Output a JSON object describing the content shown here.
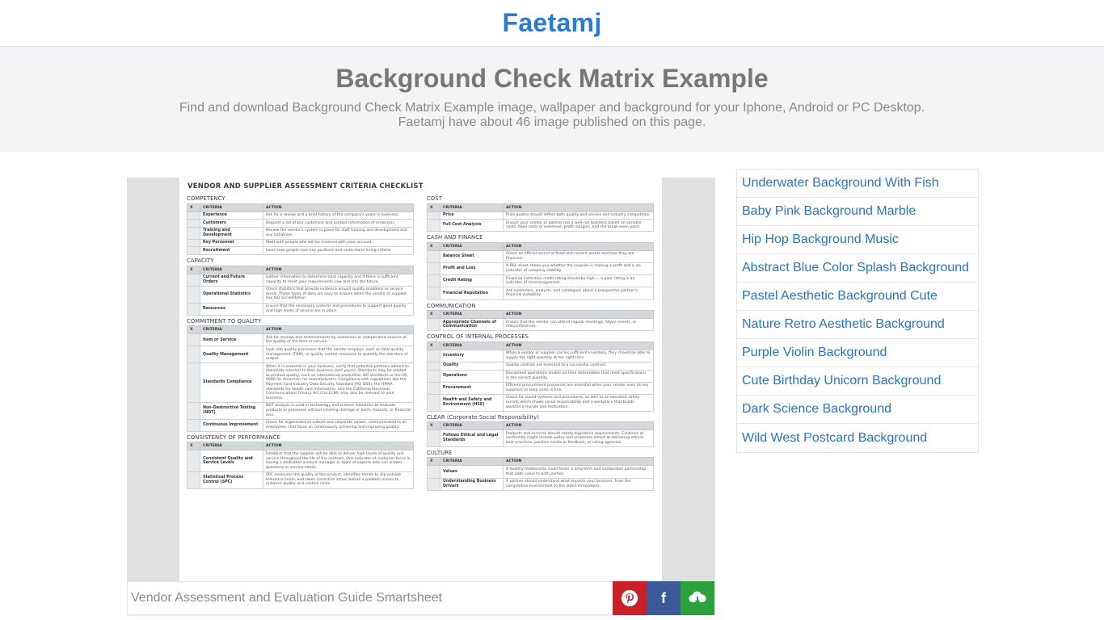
{
  "site": {
    "brand": "Faetamj"
  },
  "hero": {
    "title": "Background Check Matrix Example",
    "description_line1": "Find and download Background Check Matrix Example image, wallpaper and background for your Iphone, Android or PC Desktop.",
    "description_line2": "Faetamj have about 46 image published on this page."
  },
  "image": {
    "caption": "Vendor Assessment and Evaluation Guide Smartsheet",
    "document": {
      "title": "VENDOR AND SUPPLIER ASSESSMENT CRITERIA CHECKLIST",
      "headers": {
        "x": "X",
        "criteria": "CRITERIA",
        "action": "ACTION"
      },
      "left_sections": [
        {
          "title": "COMPETENCY",
          "rows": [
            {
              "criteria": "Experience",
              "action": "Ask for a review and a brief history of the company's years in business."
            },
            {
              "criteria": "Customers",
              "action": "Request a list of key customers and contact information of endorsers."
            },
            {
              "criteria": "Training and Development",
              "action": "Review the vendor's system in place for staff training and development and any initiatives."
            },
            {
              "criteria": "Key Personnel",
              "action": "Meet with people who will be involved with your account."
            },
            {
              "criteria": "Recruitment",
              "action": "Learn how people earn key positions and understand hiring criteria."
            }
          ]
        },
        {
          "title": "CAPACITY",
          "rows": [
            {
              "criteria": "Current and Future Orders",
              "action": "Gather information to determine total capacity and if there is sufficient capacity to meet your requirements now and into the future."
            },
            {
              "criteria": "Operational Statistics",
              "action": "Check statistics that provide evidence around quality problems or service levels. These types of data are easy to acquire when the vendor or supplier has ISO accreditation."
            },
            {
              "criteria": "Resources",
              "action": "Ensure that the necessary systems and procedures to support good quality and high levels of service are in place."
            }
          ]
        },
        {
          "title": "COMMITMENT TO QUALITY",
          "rows": [
            {
              "criteria": "Item or Service",
              "action": "Ask for reviews and endorsements by customers or independent sources of the quality of the item or service."
            },
            {
              "criteria": "Quality Management",
              "action": "Look into quality processes that the vendor employs, such as total quality management (TQM), or quality control measures to quantify the standard of output."
            },
            {
              "criteria": "Standards Compliance",
              "action": "When it is essential in your business, verify that potential partners adhere to standards relevant to their business (and yours). Standards may be related to product quality, such as international production ISO standards or the QS 9000 for American car manufacturers. Compliance with regulations like the Payment Card Industry Data Security Standard (PCI DSS), the HIPAA standards for health care information, and the California Electronic Communications Privacy Act (Cal ECPA) may also be relevant to your business."
            },
            {
              "criteria": "Non-Destructive Testing (NDT)",
              "action": "NDT analysis is used in technology and science industries to evaluate products or processes without creating damage or harm, hazards, or financial loss."
            },
            {
              "criteria": "Continuous Improvement",
              "action": "Check for organizational culture and corporate values, communicated to all employees, that focus on continuously achieving and improving quality."
            }
          ]
        },
        {
          "title": "CONSISTENCY OF PERFORMANCE",
          "rows": [
            {
              "criteria": "Consistent Quality and Service Levels",
              "action": "Establish that the supplier will be able to deliver high levels of quality and service throughout the life of the contract. One indicator of customer focus is having a dedicated account manager or team of experts who can answer questions or service needs."
            },
            {
              "criteria": "Statistical Process Control (SPC)",
              "action": "SPC measures the quality of the product, identifies trends to slip outside tolerance limits, and takes corrective action before a problem occurs to enhance quality and contain costs."
            }
          ]
        }
      ],
      "right_sections": [
        {
          "title": "COST",
          "rows": [
            {
              "criteria": "Price",
              "action": "Price quotes should reflect both quality and service and industry competition."
            },
            {
              "criteria": "Full Cost Analysis",
              "action": "Ensure your vendor or partner has a well-run business based on variable costs, fixed costs or overhead, profit margins, and the break-even point."
            }
          ]
        },
        {
          "title": "CASH AND FINANCE",
          "rows": [
            {
              "criteria": "Balance Sheet",
              "action": "Check an official record of fixed and current assets and how they are financed."
            },
            {
              "criteria": "Profit and Loss",
              "action": "A P&L sheet shows you whether the supplier is making a profit and is an indicator of company stability."
            },
            {
              "criteria": "Credit Rating",
              "action": "Financial institution credit rating should be high — a poor rating is an indicator of mismanagement."
            },
            {
              "criteria": "Financial Reputation",
              "action": "Ask customers, analysts, and colleagues about a prospective partner's financial suitability."
            }
          ]
        },
        {
          "title": "COMMUNICATION",
          "rows": [
            {
              "criteria": "Appropriate Channels of Communication",
              "action": "Ensure that the vendor can attend regular meetings, Skype events, or teleconferences."
            }
          ]
        },
        {
          "title": "CONTROL OF INTERNAL PROCESSES",
          "rows": [
            {
              "criteria": "Inventory",
              "action": "When a vendor or supplier carries sufficient inventory, they should be able to supply the right quantity at the right time."
            },
            {
              "criteria": "Quality",
              "action": "Quality controls are essential to a successful contract."
            },
            {
              "criteria": "Operations",
              "action": "Disciplined operations enable on-time deliverables that meet specifications in the correct quantity."
            },
            {
              "criteria": "Procurement",
              "action": "Efficient procurement processes are essential when your vendor uses its key suppliers to keep costs in line."
            },
            {
              "criteria": "Health and Safety and Environment (HSE)",
              "action": "Check for sound systems and procedures, as well as an excellent safety record, which shows social responsibility and a workplace that builds workforce morale and motivation."
            }
          ]
        },
        {
          "title": "CLEAR (Corporate Social Responsibility)",
          "rows": [
            {
              "criteria": "Follows Ethical and Legal Standards",
              "action": "Products and services should satisfy legislative requirements. Evidence of conformity might include policy and processes aimed at delivering ethical best practices, positive media or feedback, or rating agencies."
            }
          ]
        },
        {
          "title": "CULTURE",
          "rows": [
            {
              "criteria": "Values",
              "action": "A healthy relationship could foster a long-term and sustainable partnership that adds value to both parties."
            },
            {
              "criteria": "Understanding Business Drivers",
              "action": "A partner should understand what impacts your business, from the competitive environment to the latest innovations."
            }
          ]
        }
      ]
    }
  },
  "share": {
    "pinterest": {
      "icon": "pinterest-icon",
      "glyph": "P",
      "color": "#cb2027"
    },
    "facebook": {
      "icon": "facebook-icon",
      "glyph": "f",
      "color": "#3b5998"
    },
    "download": {
      "icon": "cloud-download-icon",
      "color": "#2aa13a"
    }
  },
  "sidebar": {
    "links": [
      "Underwater Background With Fish",
      "Baby Pink Background Marble",
      "Hip Hop Background Music",
      "Abstract Blue Color Splash Background",
      "Pastel Aesthetic Background Cute",
      "Nature Retro Aesthetic Background",
      "Purple Violin Background",
      "Cute Birthday Unicorn Background",
      "Dark Science Background",
      "Wild West Postcard Background"
    ]
  },
  "colors": {
    "brand": "#2a7ad2",
    "link": "#2a74c5",
    "hero_bg": "#f3f4f5"
  }
}
